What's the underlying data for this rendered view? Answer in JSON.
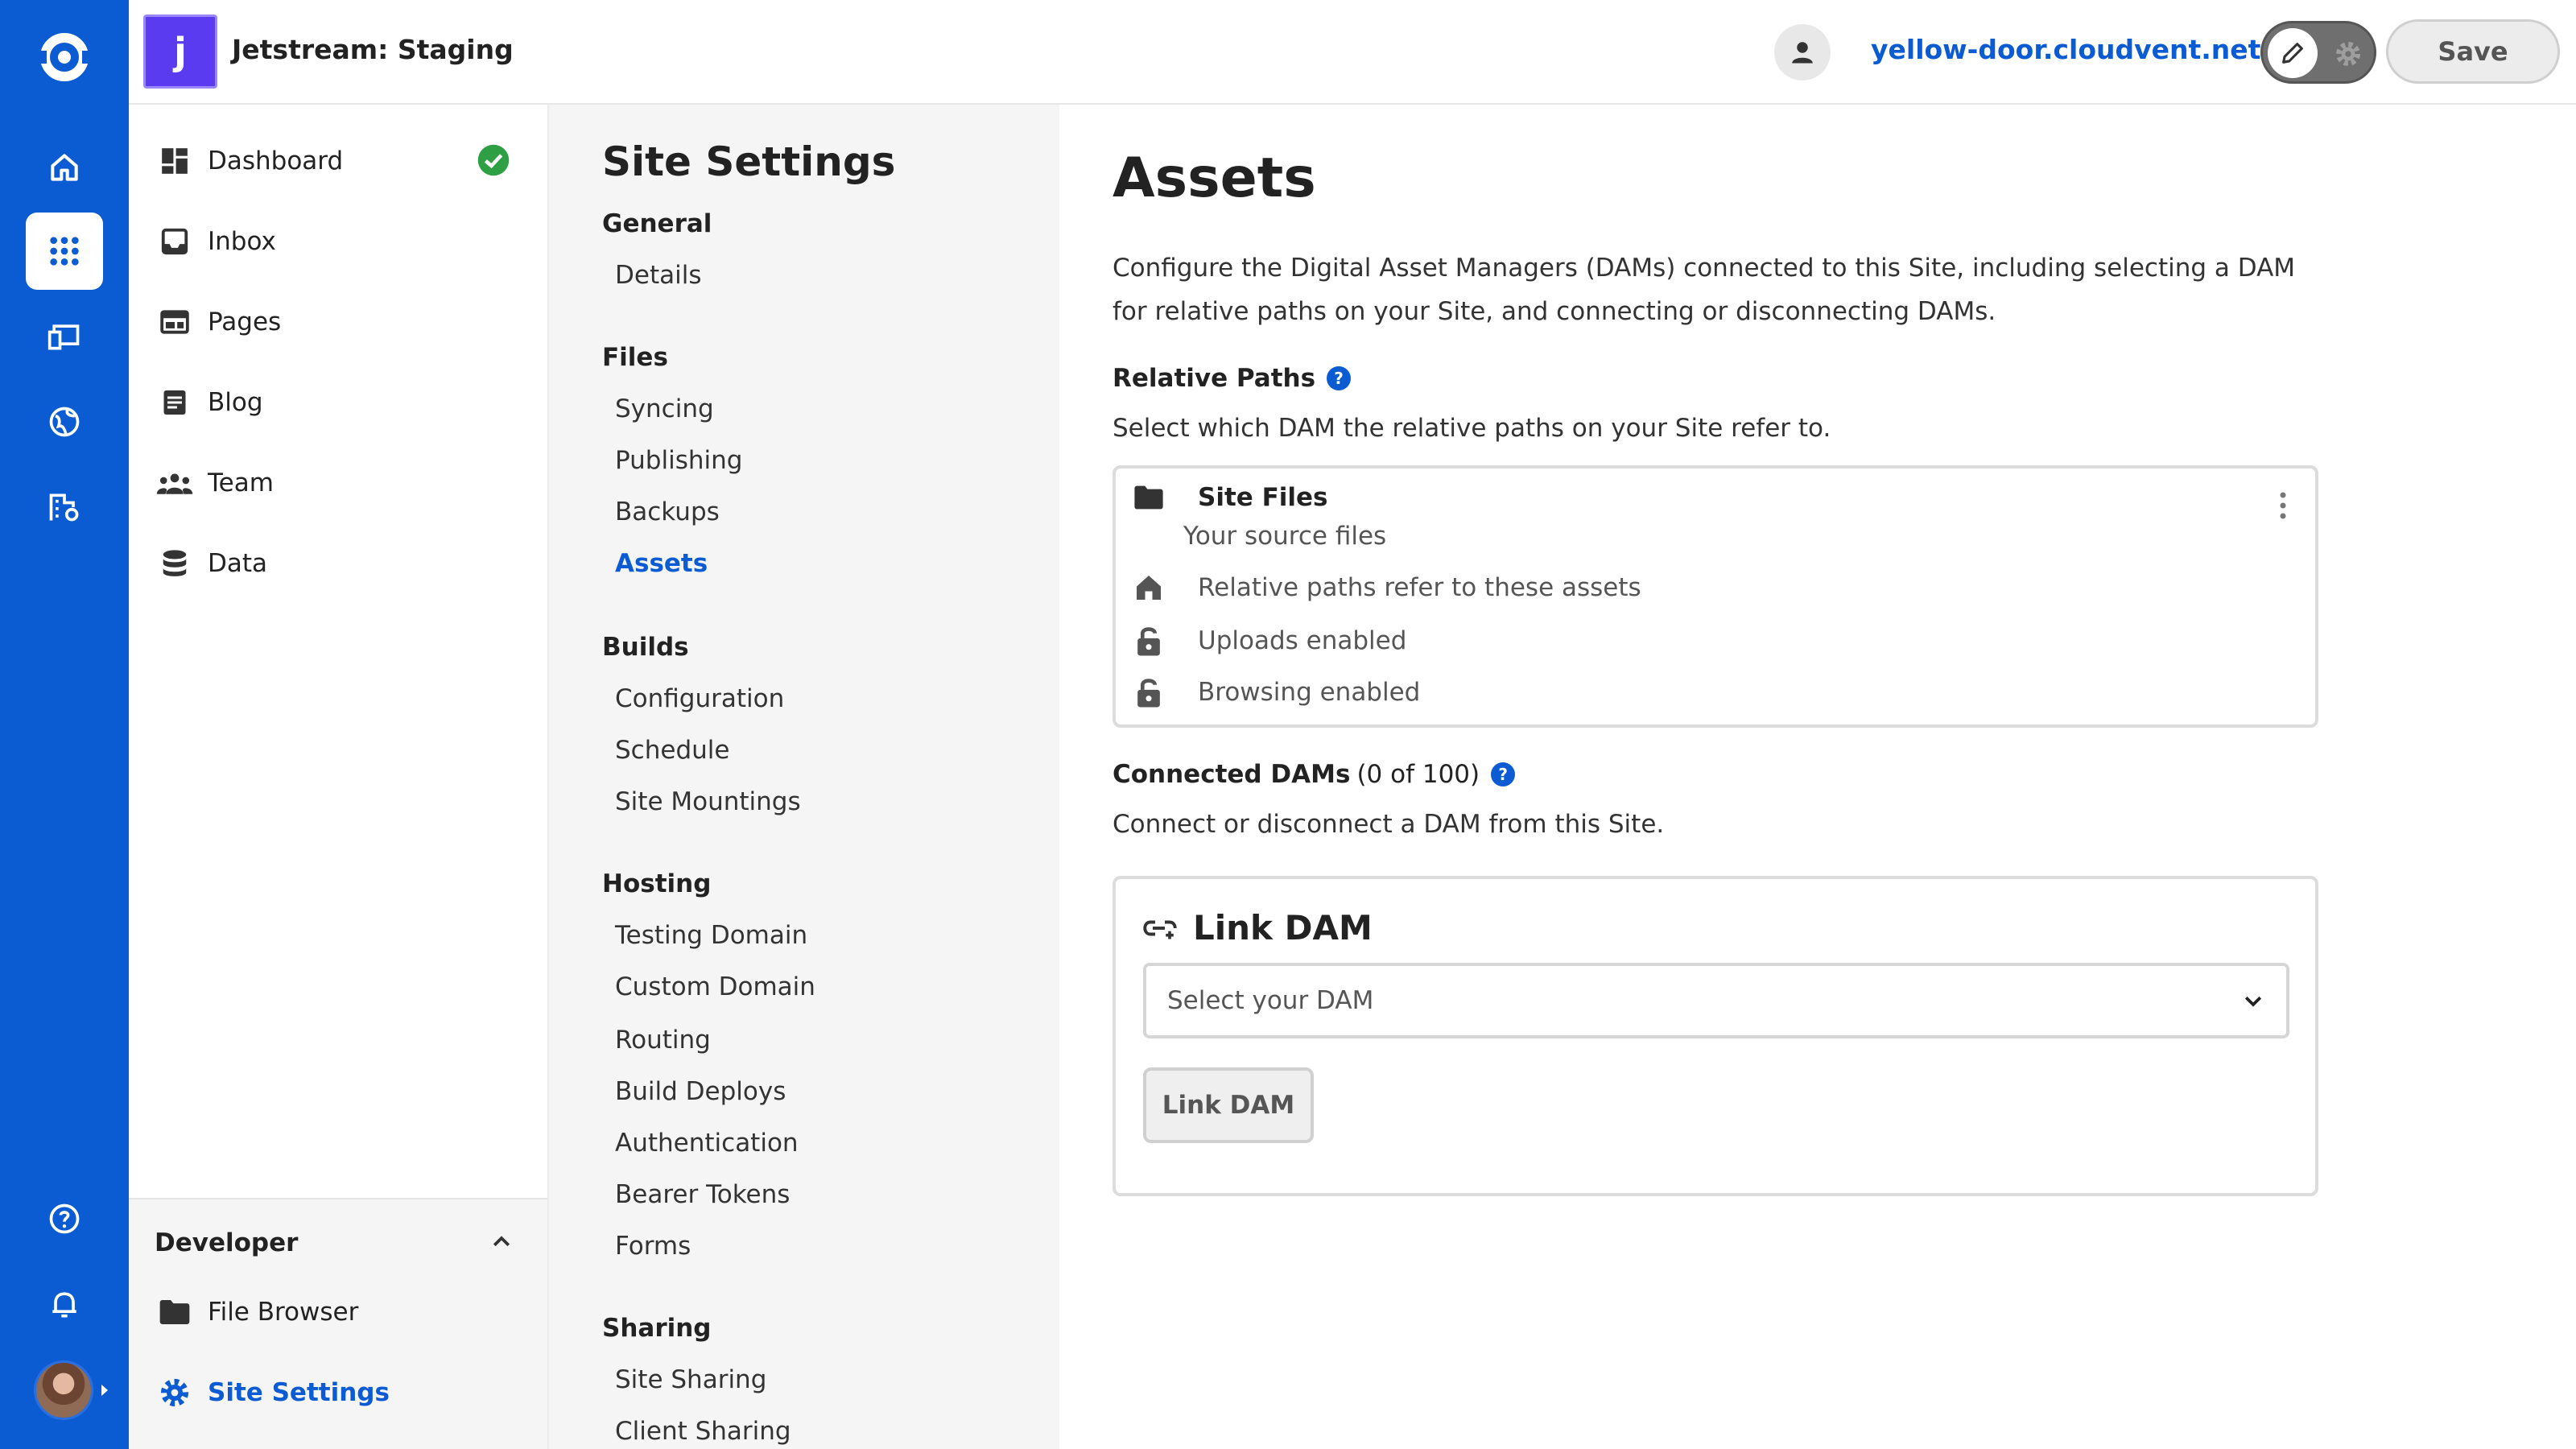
{
  "topbar": {
    "site_badge_letter": "j",
    "site_name": "Jetstream: Staging",
    "site_url": "yellow-door.cloudvent.net",
    "save_label": "Save"
  },
  "nav": {
    "items": [
      {
        "label": "Dashboard",
        "icon": "dashboard-icon",
        "status": "ok"
      },
      {
        "label": "Inbox",
        "icon": "inbox-icon"
      },
      {
        "label": "Pages",
        "icon": "pages-icon"
      },
      {
        "label": "Blog",
        "icon": "blog-icon"
      },
      {
        "label": "Team",
        "icon": "team-icon"
      },
      {
        "label": "Data",
        "icon": "data-icon"
      }
    ],
    "developer": {
      "title": "Developer",
      "items": [
        {
          "label": "File Browser",
          "icon": "folder-icon"
        },
        {
          "label": "Site Settings",
          "icon": "gear-icon",
          "active": true
        }
      ]
    }
  },
  "subnav": {
    "title": "Site Settings",
    "groups": [
      {
        "label": "General",
        "links": [
          "Details"
        ]
      },
      {
        "label": "Files",
        "links": [
          "Syncing",
          "Publishing",
          "Backups",
          "Assets"
        ]
      },
      {
        "label": "Builds",
        "links": [
          "Configuration",
          "Schedule",
          "Site Mountings"
        ]
      },
      {
        "label": "Hosting",
        "links": [
          "Testing Domain",
          "Custom Domain",
          "Routing",
          "Build Deploys",
          "Authentication",
          "Bearer Tokens",
          "Forms"
        ]
      },
      {
        "label": "Sharing",
        "links": [
          "Site Sharing",
          "Client Sharing"
        ]
      }
    ],
    "active_link": "Assets"
  },
  "main": {
    "title": "Assets",
    "description": "Configure the Digital Asset Managers (DAMs) connected to this Site, including selecting a DAM for relative paths on your Site, and connecting or disconnecting DAMs.",
    "relative_paths": {
      "heading": "Relative Paths",
      "description": "Select which DAM the relative paths on your Site refer to.",
      "card": {
        "name": "Site Files",
        "subtitle": "Your source files",
        "features": [
          {
            "label": "Relative paths refer to these assets",
            "icon": "home-icon"
          },
          {
            "label": "Uploads enabled",
            "icon": "unlock-icon"
          },
          {
            "label": "Browsing enabled",
            "icon": "unlock-icon"
          }
        ]
      }
    },
    "connected_dams": {
      "heading": "Connected DAMs",
      "count": "(0 of 100)",
      "description": "Connect or disconnect a DAM from this Site.",
      "link_card": {
        "title": "Link DAM",
        "select_placeholder": "Select your DAM",
        "button_label": "Link DAM"
      }
    }
  },
  "colors": {
    "brand_blue": "#0b5bd3",
    "site_badge": "#5b3bf0",
    "success_green": "#2ea043"
  }
}
